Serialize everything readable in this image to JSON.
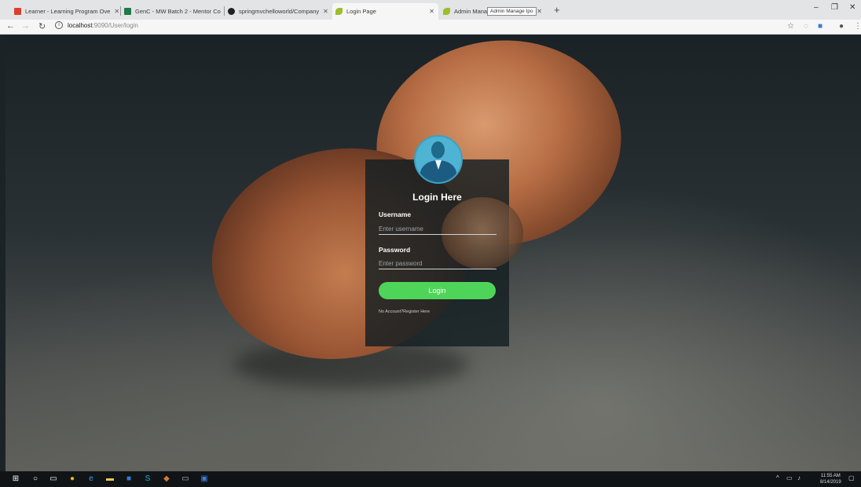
{
  "browser": {
    "tabs": [
      {
        "title": "Learner - Learning Program Ove",
        "favicon": "adobe-icon",
        "color": "#d9402b"
      },
      {
        "title": "GenC - MW Batch 2 - Mentor Co",
        "favicon": "sheets-icon",
        "color": "#1e7a4a"
      },
      {
        "title": "springmvchelloworld/Company",
        "favicon": "github-icon",
        "color": "#222222"
      },
      {
        "title": "Login Page",
        "favicon": "leaf-icon",
        "color": "#9bbf2a"
      },
      {
        "title": "Admin Manage Ipo",
        "favicon": "leaf-icon",
        "color": "#9bbf2a"
      }
    ],
    "tooltip": "Admin Manage Ipo",
    "url_host": "localhost",
    "url_path": ":9090/User/login",
    "new_tab": "+",
    "minimize": "–",
    "restore": "❐",
    "close": "✕"
  },
  "login": {
    "title": "Login Here",
    "username_label": "Username",
    "username_placeholder": "Enter username",
    "password_label": "Password",
    "password_placeholder": "Enter password",
    "button_label": "Login",
    "register_link": "No Account?Register Here"
  },
  "taskbar": {
    "time": "11:55 AM",
    "date": "8/14/2019"
  },
  "colors": {
    "login_button": "#4fd45a",
    "avatar": "#4fb3d4",
    "card": "#141e22"
  }
}
